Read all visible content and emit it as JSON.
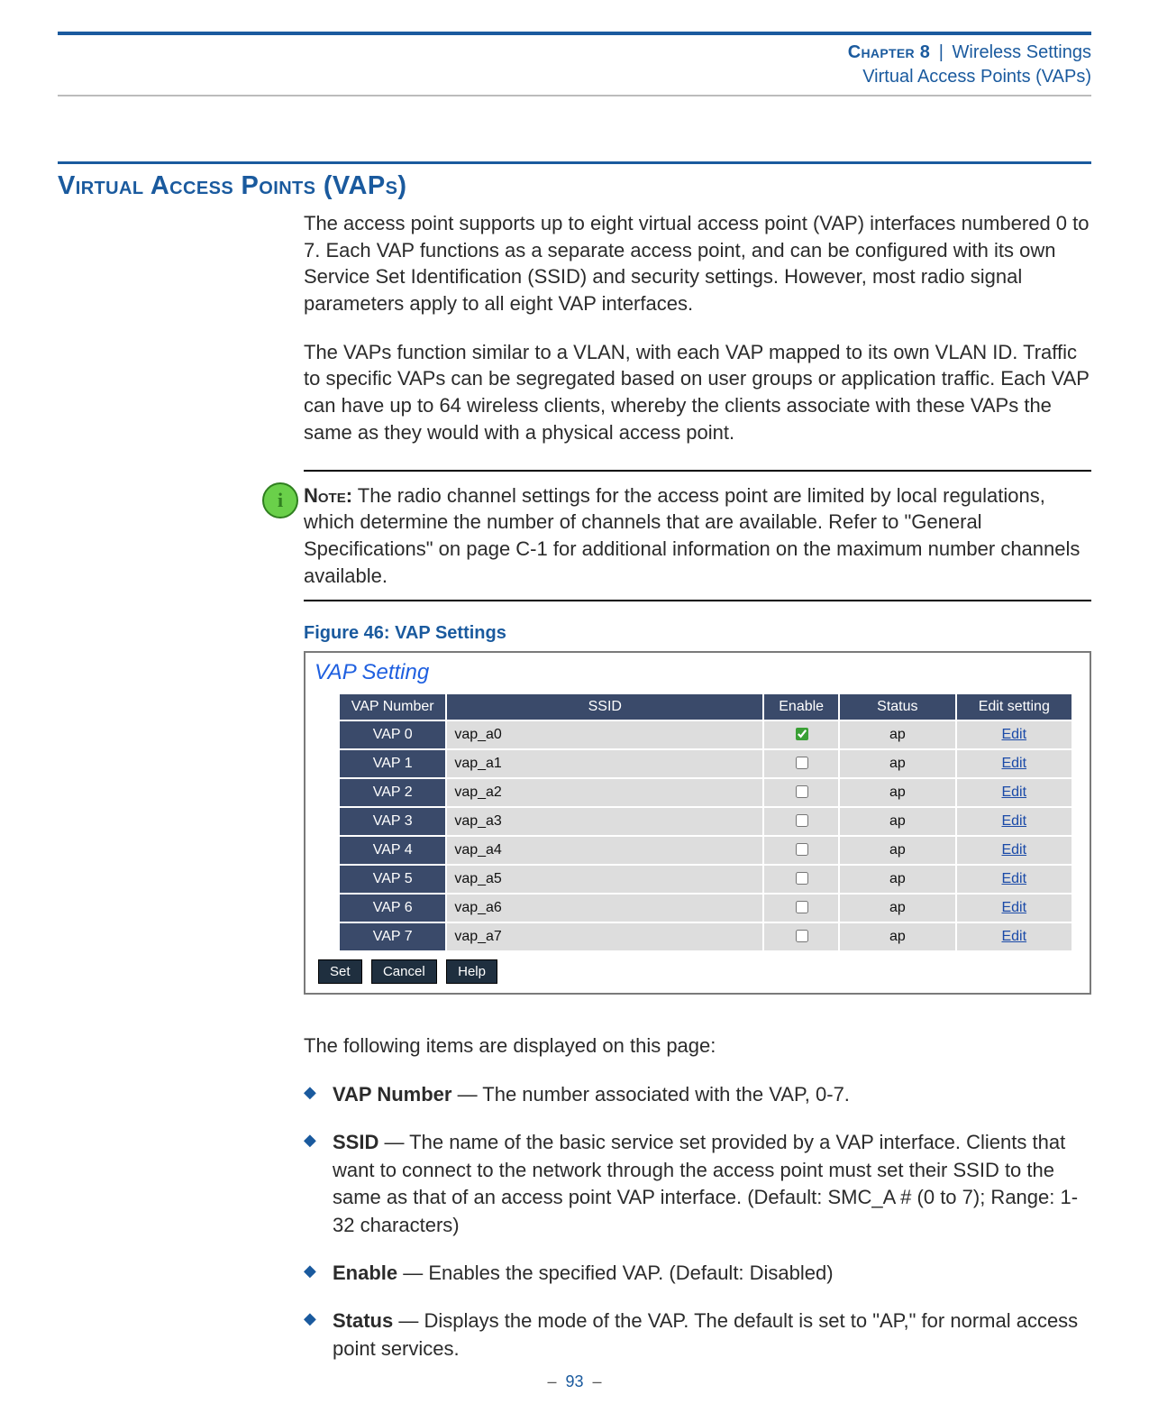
{
  "header": {
    "chapter_label": "Chapter 8",
    "separator": "|",
    "chapter_title": "Wireless Settings",
    "subsection": "Virtual Access Points (VAPs)"
  },
  "section": {
    "title": "Virtual Access Points (VAPs)",
    "paragraphs": [
      "The access point supports up to eight virtual access point (VAP) interfaces numbered 0 to 7. Each VAP functions as a separate access point, and can be configured with its own Service Set Identification (SSID) and security settings. However, most radio signal parameters apply to all eight VAP interfaces.",
      "The VAPs function similar to a VLAN, with each VAP mapped to its own VLAN ID. Traffic to specific VAPs can be segregated based on user groups or application traffic. Each VAP can have up to 64 wireless clients, whereby the clients associate with these VAPs the same as they would with a physical access point."
    ]
  },
  "note": {
    "label": "Note:",
    "text": " The radio channel settings for the access point are limited by local regulations, which determine the number of channels that are available. Refer to \"General Specifications\" on page C-1 for additional information on the maximum number channels available.",
    "icon_glyph": "i"
  },
  "figure": {
    "caption": "Figure 46:  VAP Settings",
    "panel_title": "VAP Setting",
    "columns": {
      "vap_number": "VAP Number",
      "ssid": "SSID",
      "enable": "Enable",
      "status": "Status",
      "edit": "Edit setting"
    },
    "edit_label": "Edit",
    "rows": [
      {
        "vap": "VAP 0",
        "ssid": "vap_a0",
        "enabled": true,
        "status": "ap"
      },
      {
        "vap": "VAP 1",
        "ssid": "vap_a1",
        "enabled": false,
        "status": "ap"
      },
      {
        "vap": "VAP 2",
        "ssid": "vap_a2",
        "enabled": false,
        "status": "ap"
      },
      {
        "vap": "VAP 3",
        "ssid": "vap_a3",
        "enabled": false,
        "status": "ap"
      },
      {
        "vap": "VAP 4",
        "ssid": "vap_a4",
        "enabled": false,
        "status": "ap"
      },
      {
        "vap": "VAP 5",
        "ssid": "vap_a5",
        "enabled": false,
        "status": "ap"
      },
      {
        "vap": "VAP 6",
        "ssid": "vap_a6",
        "enabled": false,
        "status": "ap"
      },
      {
        "vap": "VAP 7",
        "ssid": "vap_a7",
        "enabled": false,
        "status": "ap"
      }
    ],
    "buttons": {
      "set": "Set",
      "cancel": "Cancel",
      "help": "Help"
    }
  },
  "items_intro": "The following items are displayed on this page:",
  "items": [
    {
      "label": "VAP Number",
      "text": " — The number associated with the VAP, 0-7."
    },
    {
      "label": "SSID",
      "text": " — The name of the basic service set provided by a VAP interface. Clients that want to connect to the network through the access point must set their SSID to the same as that of an access point VAP interface. (Default: SMC_A # (0 to 7); Range: 1-32 characters)"
    },
    {
      "label": "Enable",
      "text": " — Enables the specified VAP. (Default: Disabled)"
    },
    {
      "label": "Status",
      "text": " — Displays the mode of the VAP. The default is set to \"AP,\" for normal access point services."
    }
  ],
  "footer": {
    "dash": "–",
    "page_number": "93"
  }
}
